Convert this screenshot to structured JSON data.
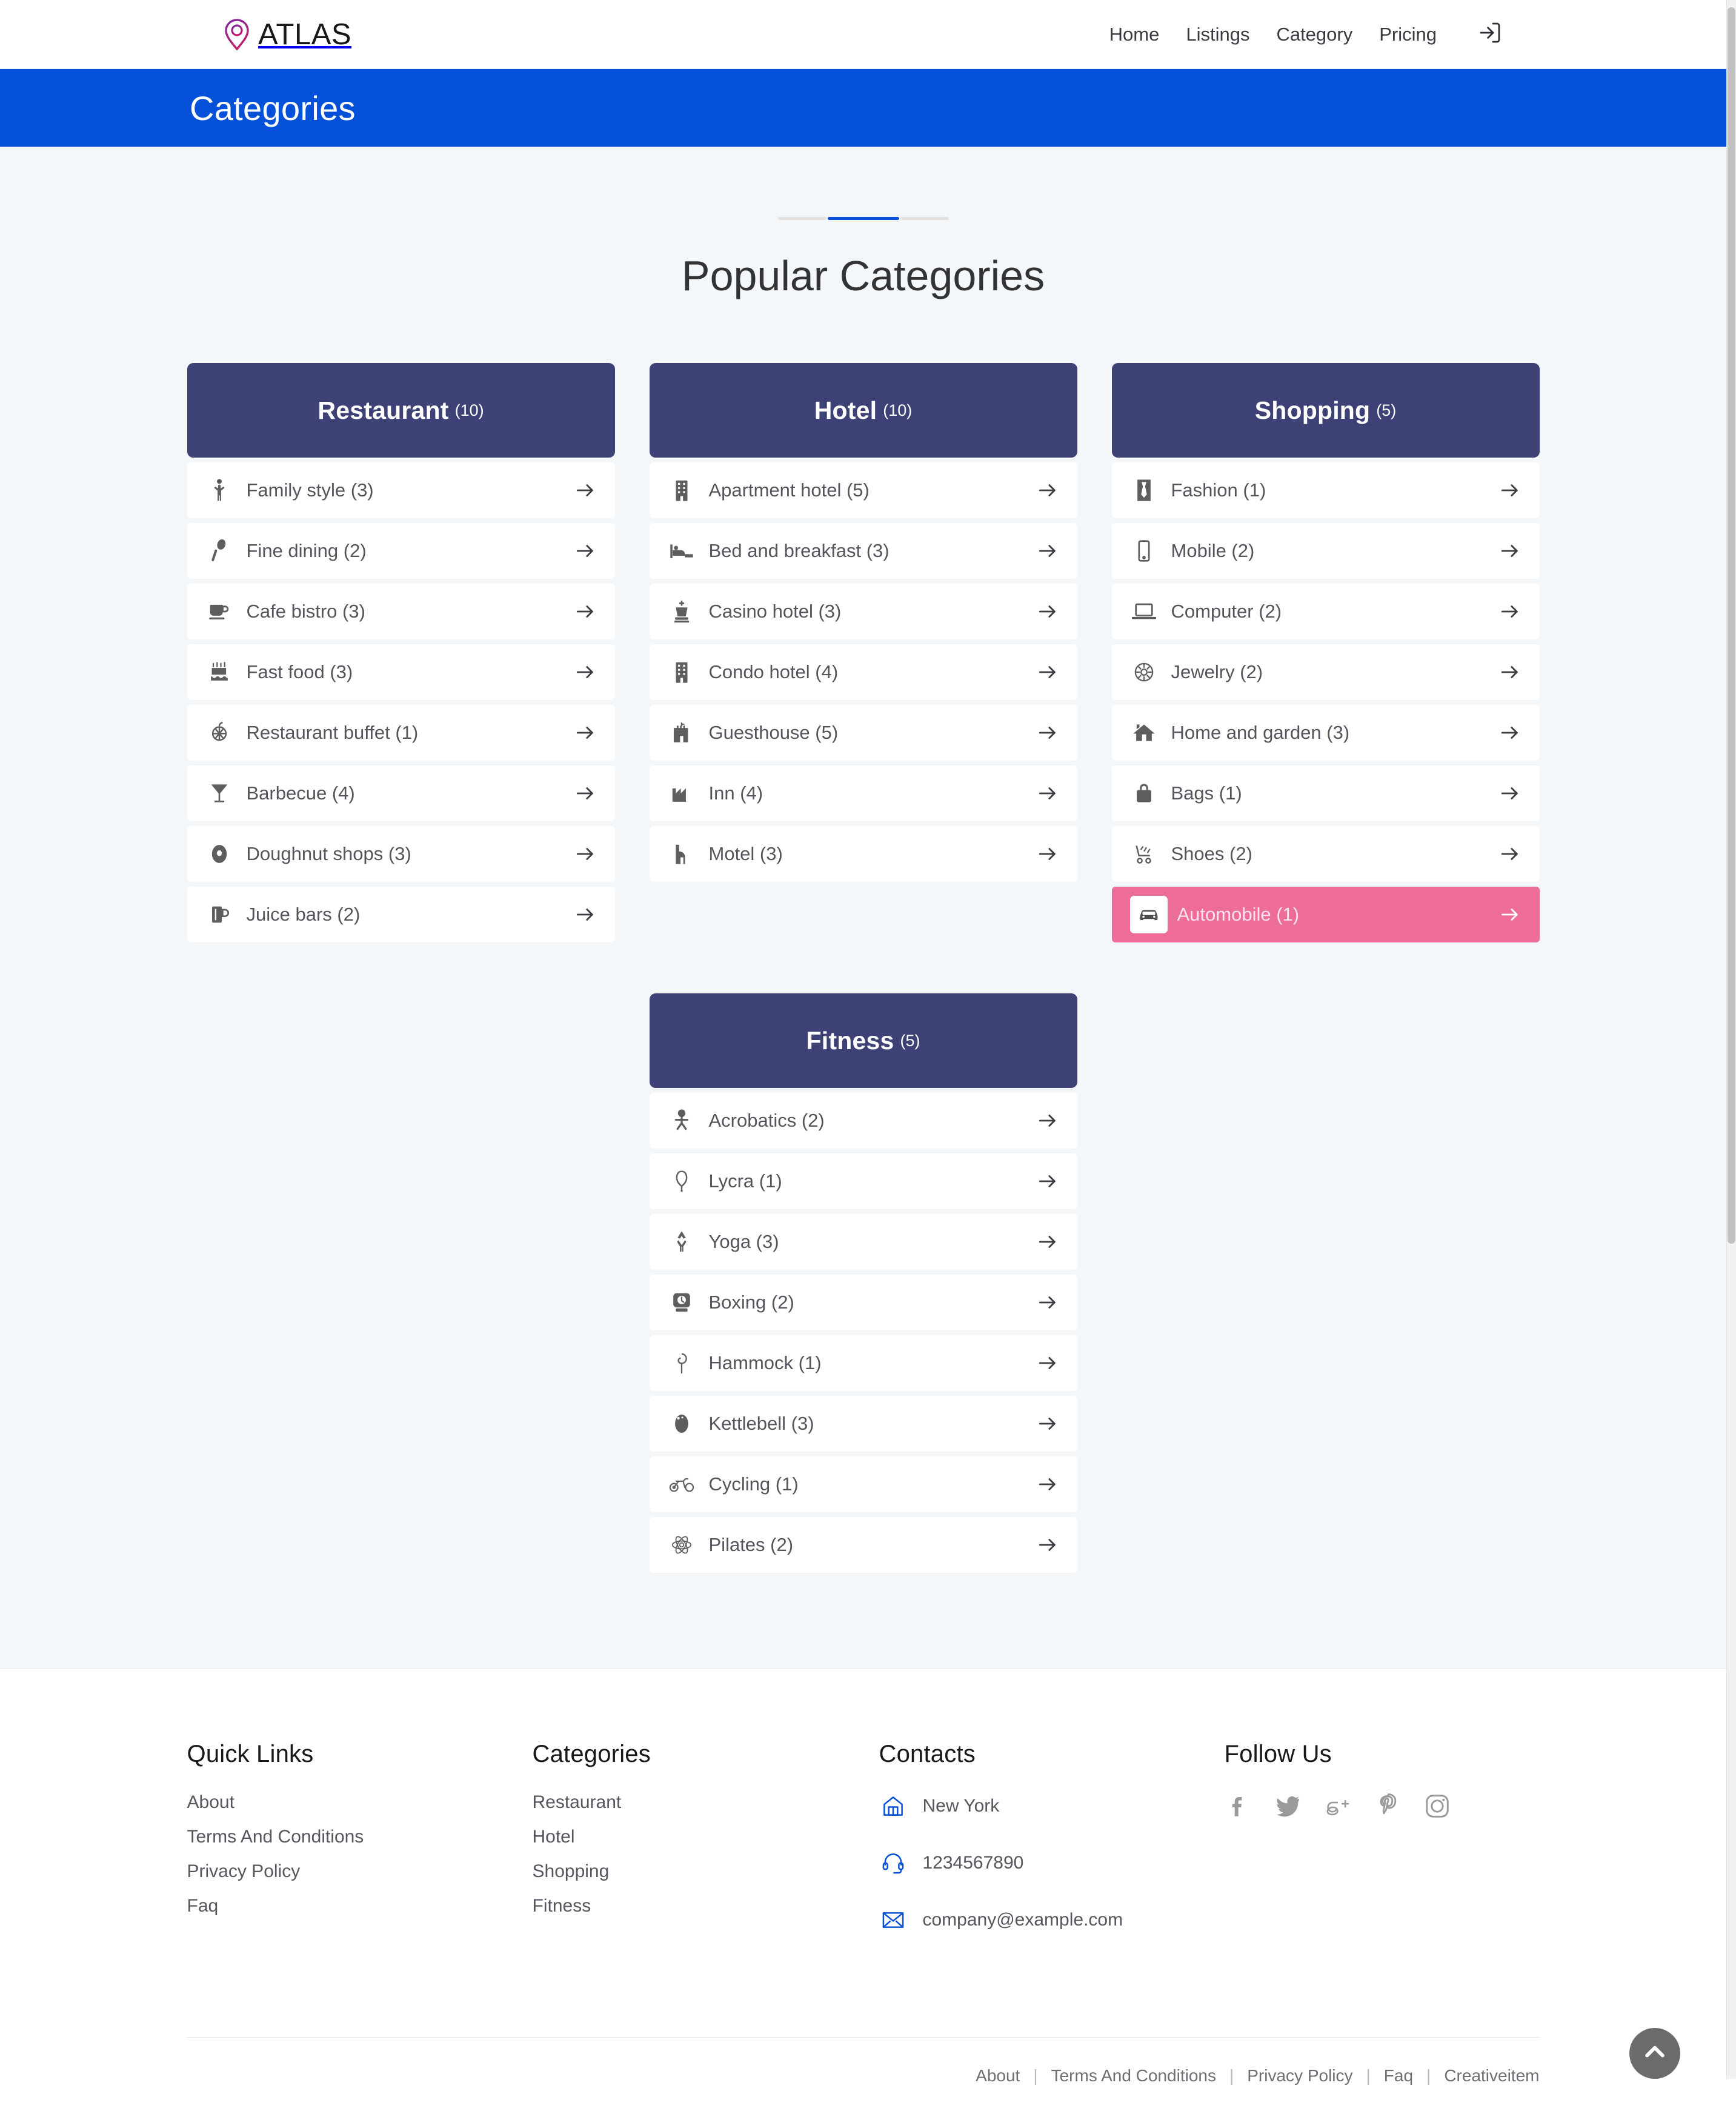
{
  "header": {
    "brand": "ATLAS",
    "nav": [
      {
        "label": "Home"
      },
      {
        "label": "Listings"
      },
      {
        "label": "Category"
      },
      {
        "label": "Pricing"
      }
    ],
    "login_icon": "login-arrow-icon"
  },
  "banner": {
    "title": "Categories",
    "color": "#0450d8"
  },
  "section": {
    "title": "Popular Categories",
    "divider_color": "#0450d8"
  },
  "colors": {
    "card_header": "#3e4176",
    "accent_blue": "#0450d8",
    "active_pink": "#ee6c99",
    "page_bg": "#f4f7fa"
  },
  "cards": [
    {
      "title": "Restaurant",
      "count": "(10)",
      "items": [
        {
          "icon": "person-icon",
          "label": "Family style (3)"
        },
        {
          "icon": "spoon-icon",
          "label": "Fine dining (2)"
        },
        {
          "icon": "coffee-cup-icon",
          "label": "Cafe bistro (3)"
        },
        {
          "icon": "cake-icon",
          "label": "Fast food (3)"
        },
        {
          "icon": "basket-icon",
          "label": "Restaurant buffet (1)"
        },
        {
          "icon": "cocktail-icon",
          "label": "Barbecue (4)"
        },
        {
          "icon": "doughnut-icon",
          "label": "Doughnut shops (3)"
        },
        {
          "icon": "beer-mug-icon",
          "label": "Juice bars (2)"
        }
      ]
    },
    {
      "title": "Hotel",
      "count": "(10)",
      "items": [
        {
          "icon": "building-icon",
          "label": "Apartment hotel (5)"
        },
        {
          "icon": "bed-icon",
          "label": "Bed and breakfast (3)"
        },
        {
          "icon": "chess-king-icon",
          "label": "Casino hotel (3)"
        },
        {
          "icon": "building-icon",
          "label": "Condo hotel (4)"
        },
        {
          "icon": "castle-icon",
          "label": "Guesthouse (5)"
        },
        {
          "icon": "factory-icon",
          "label": "Inn (4)"
        },
        {
          "icon": "motel-icon",
          "label": "Motel (3)"
        }
      ]
    },
    {
      "title": "Shopping",
      "count": "(5)",
      "items": [
        {
          "icon": "tie-icon",
          "label": "Fashion (1)"
        },
        {
          "icon": "mobile-phone-icon",
          "label": "Mobile (2)"
        },
        {
          "icon": "laptop-icon",
          "label": "Computer (2)"
        },
        {
          "icon": "gem-icon",
          "label": "Jewelry (2)"
        },
        {
          "icon": "home-icon",
          "label": "Home and garden (3)"
        },
        {
          "icon": "handbag-icon",
          "label": "Bags (1)"
        },
        {
          "icon": "shoe-icon",
          "label": "Shoes (2)"
        },
        {
          "icon": "car-icon",
          "label": "Automobile (1)",
          "active": true
        }
      ]
    },
    {
      "title": "Fitness",
      "count": "(5)",
      "items": [
        {
          "icon": "acrobat-icon",
          "label": "Acrobatics (2)"
        },
        {
          "icon": "balloon-icon",
          "label": "Lycra (1)"
        },
        {
          "icon": "yoga-pose-icon",
          "label": "Yoga (3)"
        },
        {
          "icon": "boxing-glove-icon",
          "label": "Boxing (2)"
        },
        {
          "icon": "hammock-icon",
          "label": "Hammock (1)"
        },
        {
          "icon": "kettlebell-icon",
          "label": "Kettlebell (3)"
        },
        {
          "icon": "bicycle-icon",
          "label": "Cycling (1)"
        },
        {
          "icon": "atom-icon",
          "label": "Pilates (2)"
        }
      ]
    }
  ],
  "footer": {
    "quick_links": {
      "heading": "Quick Links",
      "items": [
        "About",
        "Terms And Conditions",
        "Privacy Policy",
        "Faq"
      ]
    },
    "categories": {
      "heading": "Categories",
      "items": [
        "Restaurant",
        "Hotel",
        "Shopping",
        "Fitness"
      ]
    },
    "contacts": {
      "heading": "Contacts",
      "items": [
        {
          "icon": "home-outline-icon",
          "text": "New York"
        },
        {
          "icon": "headset-outline-icon",
          "text": "1234567890"
        },
        {
          "icon": "envelope-outline-icon",
          "text": "company@example.com"
        }
      ]
    },
    "follow": {
      "heading": "Follow Us",
      "items": [
        {
          "icon": "facebook-icon"
        },
        {
          "icon": "twitter-icon"
        },
        {
          "icon": "google-plus-icon"
        },
        {
          "icon": "pinterest-icon"
        },
        {
          "icon": "instagram-icon"
        }
      ]
    },
    "bottom_links": [
      "About",
      "Terms And Conditions",
      "Privacy Policy",
      "Faq",
      "Creativeitem"
    ],
    "bottom_separator": "|"
  },
  "scroll_top_icon": "chevron-up-icon"
}
